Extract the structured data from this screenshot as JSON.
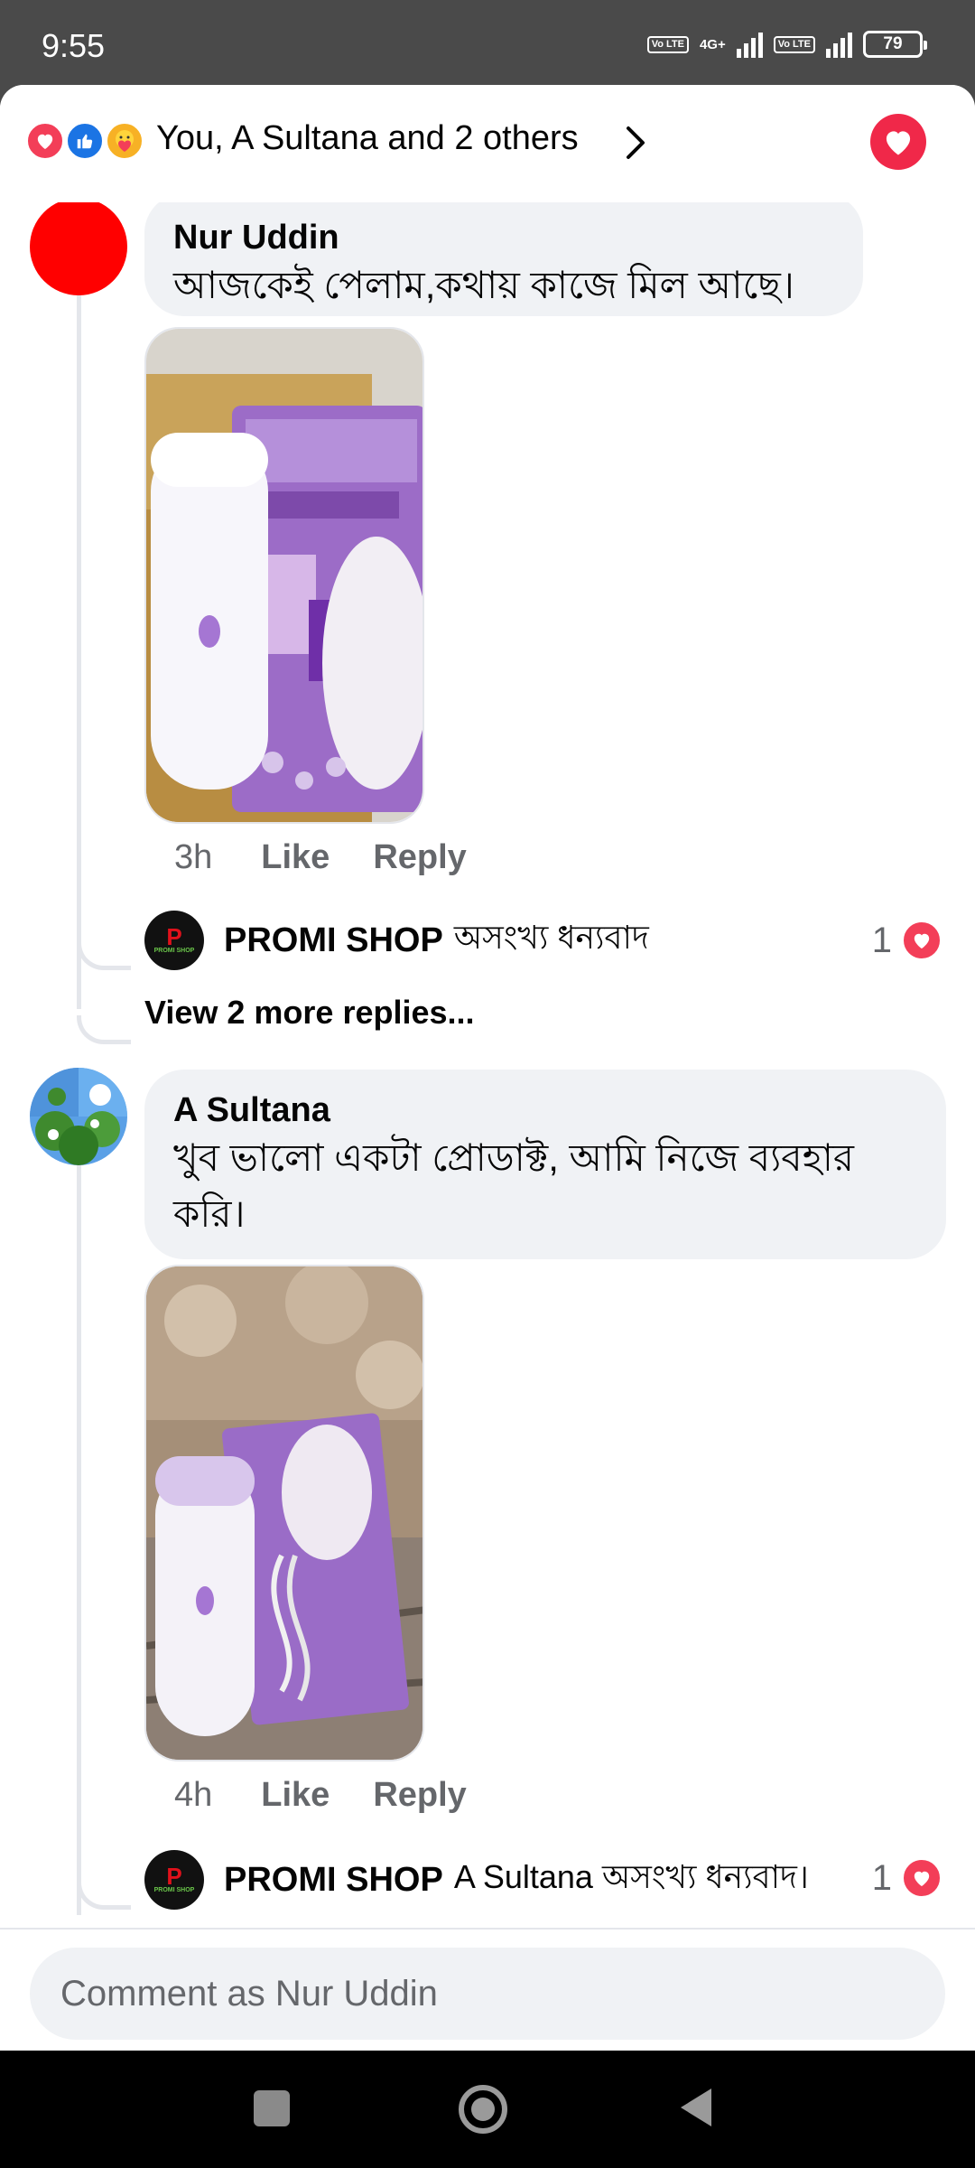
{
  "status_bar": {
    "time": "9:55",
    "sim1_badge": "Vo LTE",
    "network": "4G+",
    "sim2_badge": "Vo LTE",
    "battery": "79"
  },
  "header": {
    "reactions_summary": "You, A Sultana and 2 others",
    "icons": [
      "love-icon",
      "like-icon",
      "care-icon"
    ]
  },
  "comments": [
    {
      "author": "Nur Uddin",
      "text": "আজকেই পেলাম,কথায় কাজে মিল আছে।",
      "time": "3h",
      "like_label": "Like",
      "reply_label": "Reply",
      "reaction_count": "1",
      "photo": "boxed purple Yes Finishing Touch hair remover on cardboard",
      "reply": {
        "author": "PROMI SHOP",
        "text": "অসংখ্য ধন্যবাদ"
      },
      "more_replies": "View 2 more replies..."
    },
    {
      "author": "A Sultana",
      "text_line1": "খুব ভালো একটা প্রোডাক্ট, আমি নিজে ব্যবহার",
      "text_line2": "করি।",
      "time": "4h",
      "like_label": "Like",
      "reply_label": "Reply",
      "reaction_count": "1",
      "photo": "hair remover with box and usb cable on patterned cloth",
      "reply": {
        "author": "PROMI SHOP",
        "text": "A Sultana অসংখ্য ধন্যবাদ।"
      }
    }
  ],
  "shop_avatar": {
    "letter": "P",
    "label": "PROMI SHOP"
  },
  "composer": {
    "placeholder": "Comment as Nur Uddin"
  },
  "colors": {
    "love": "#f33e58",
    "like": "#1b74e4",
    "care": "#f7b125",
    "bubble": "#f0f2f5",
    "muted_text": "#65676b"
  }
}
